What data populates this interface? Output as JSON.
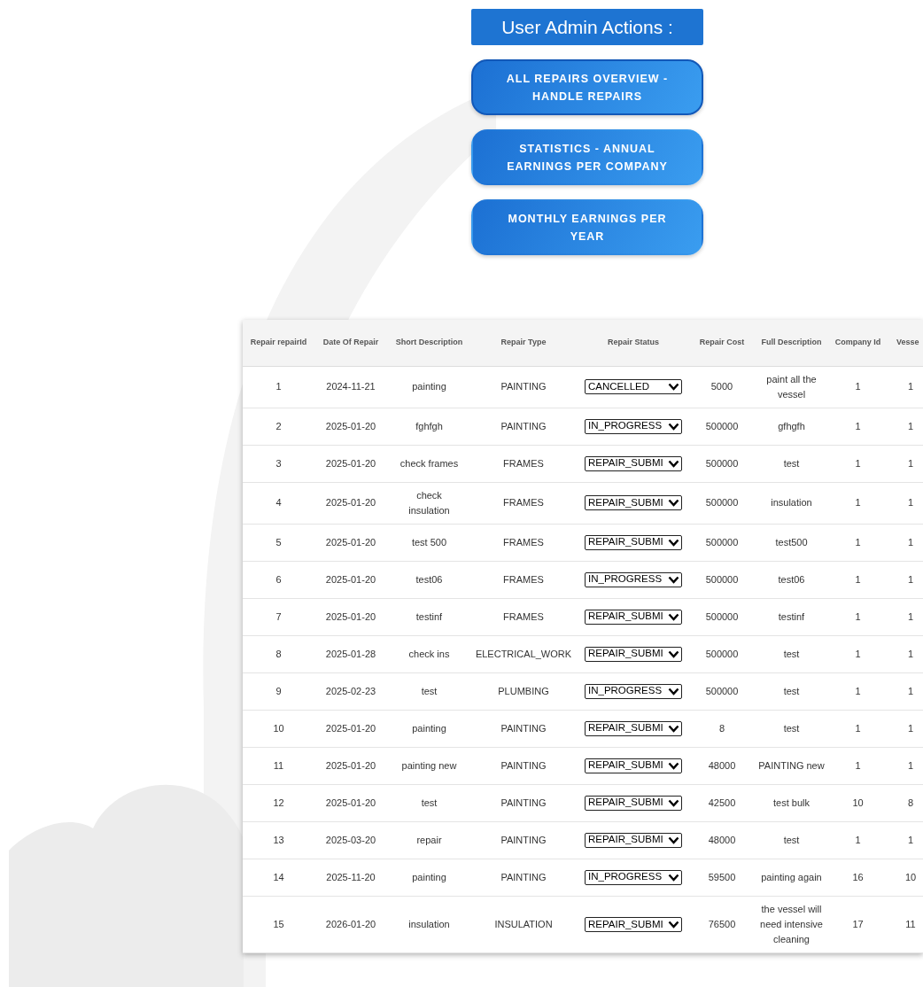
{
  "header": {
    "title": "User Admin Actions :"
  },
  "actions": [
    {
      "label": "ALL REPAIRS OVERVIEW - HANDLE REPAIRS",
      "selected": true
    },
    {
      "label": "STATISTICS - ANNUAL EARNINGS PER COMPANY",
      "selected": false
    },
    {
      "label": "MONTHLY EARNINGS PER YEAR",
      "selected": false
    }
  ],
  "table": {
    "columns": [
      "Repair repairId",
      "Date Of Repair",
      "Short Description",
      "Repair Type",
      "Repair Status",
      "Repair Cost",
      "Full Description",
      "Company Id",
      "Vesse"
    ],
    "rows": [
      [
        "1",
        "2024-11-21",
        "painting",
        "PAINTING",
        "CANCELLED",
        "5000",
        "paint all the vessel",
        "1",
        "1"
      ],
      [
        "2",
        "2025-01-20",
        "fghfgh",
        "PAINTING",
        "IN_PROGRESS",
        "500000",
        "gfhgfh",
        "1",
        "1"
      ],
      [
        "3",
        "2025-01-20",
        "check frames",
        "FRAMES",
        "REPAIR_SUBMI",
        "500000",
        "test",
        "1",
        "1"
      ],
      [
        "4",
        "2025-01-20",
        "check insulation",
        "FRAMES",
        "REPAIR_SUBMI",
        "500000",
        "insulation",
        "1",
        "1"
      ],
      [
        "5",
        "2025-01-20",
        "test 500",
        "FRAMES",
        "REPAIR_SUBMI",
        "500000",
        "test500",
        "1",
        "1"
      ],
      [
        "6",
        "2025-01-20",
        "test06",
        "FRAMES",
        "IN_PROGRESS",
        "500000",
        "test06",
        "1",
        "1"
      ],
      [
        "7",
        "2025-01-20",
        "testinf",
        "FRAMES",
        "REPAIR_SUBMI",
        "500000",
        "testinf",
        "1",
        "1"
      ],
      [
        "8",
        "2025-01-28",
        "check ins",
        "ELECTRICAL_WORK",
        "REPAIR_SUBMI",
        "500000",
        "test",
        "1",
        "1"
      ],
      [
        "9",
        "2025-02-23",
        "test",
        "PLUMBING",
        "IN_PROGRESS",
        "500000",
        "test",
        "1",
        "1"
      ],
      [
        "10",
        "2025-01-20",
        "painting",
        "PAINTING",
        "REPAIR_SUBMI",
        "8",
        "test",
        "1",
        "1"
      ],
      [
        "11",
        "2025-01-20",
        "painting new",
        "PAINTING",
        "REPAIR_SUBMI",
        "48000",
        "PAINTING new",
        "1",
        "1"
      ],
      [
        "12",
        "2025-01-20",
        "test",
        "PAINTING",
        "REPAIR_SUBMI",
        "42500",
        "test bulk",
        "10",
        "8"
      ],
      [
        "13",
        "2025-03-20",
        "repair",
        "PAINTING",
        "REPAIR_SUBMI",
        "48000",
        "test",
        "1",
        "1"
      ],
      [
        "14",
        "2025-11-20",
        "painting",
        "PAINTING",
        "IN_PROGRESS",
        "59500",
        "painting again",
        "16",
        "10"
      ],
      [
        "15",
        "2026-01-20",
        "insulation",
        "INSULATION",
        "REPAIR_SUBMI",
        "76500",
        "the vessel will need intensive cleaning",
        "17",
        "11"
      ]
    ]
  }
}
